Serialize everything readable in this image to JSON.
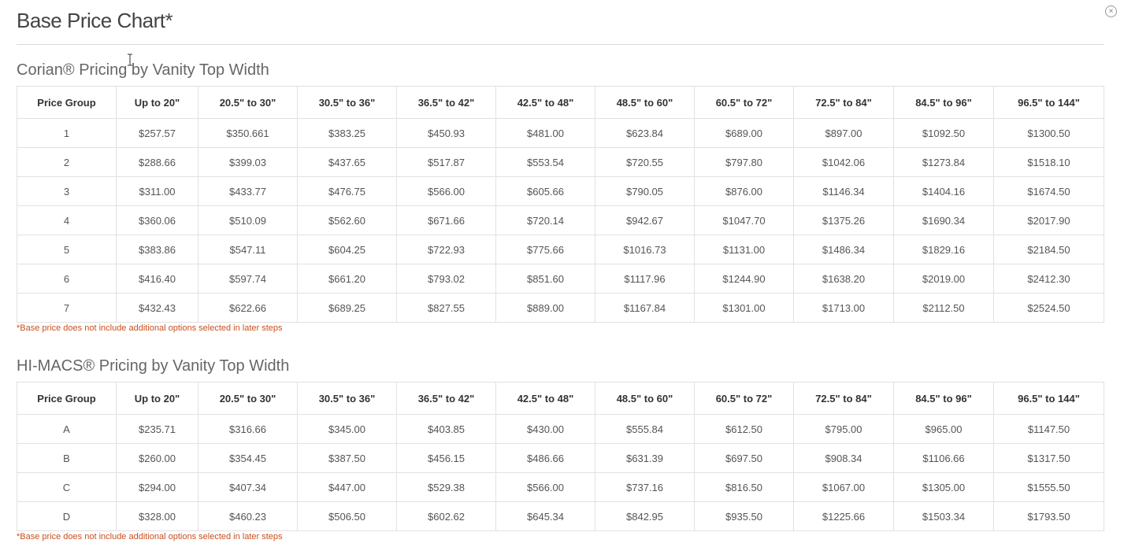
{
  "modal": {
    "title": "Base Price Chart*",
    "close_symbol": "×"
  },
  "columns": [
    "Price Group",
    "Up to 20\"",
    "20.5\" to 30\"",
    "30.5\" to 36\"",
    "36.5\" to 42\"",
    "42.5\" to 48\"",
    "48.5\" to 60\"",
    "60.5\" to 72\"",
    "72.5\" to 84\"",
    "84.5\" to 96\"",
    "96.5\" to 144\""
  ],
  "corian": {
    "title": "Corian® Pricing by Vanity Top Width",
    "rows": [
      [
        "1",
        "$257.57",
        "$350.661",
        "$383.25",
        "$450.93",
        "$481.00",
        "$623.84",
        "$689.00",
        "$897.00",
        "$1092.50",
        "$1300.50"
      ],
      [
        "2",
        "$288.66",
        "$399.03",
        "$437.65",
        "$517.87",
        "$553.54",
        "$720.55",
        "$797.80",
        "$1042.06",
        "$1273.84",
        "$1518.10"
      ],
      [
        "3",
        "$311.00",
        "$433.77",
        "$476.75",
        "$566.00",
        "$605.66",
        "$790.05",
        "$876.00",
        "$1146.34",
        "$1404.16",
        "$1674.50"
      ],
      [
        "4",
        "$360.06",
        "$510.09",
        "$562.60",
        "$671.66",
        "$720.14",
        "$942.67",
        "$1047.70",
        "$1375.26",
        "$1690.34",
        "$2017.90"
      ],
      [
        "5",
        "$383.86",
        "$547.11",
        "$604.25",
        "$722.93",
        "$775.66",
        "$1016.73",
        "$1131.00",
        "$1486.34",
        "$1829.16",
        "$2184.50"
      ],
      [
        "6",
        "$416.40",
        "$597.74",
        "$661.20",
        "$793.02",
        "$851.60",
        "$1117.96",
        "$1244.90",
        "$1638.20",
        "$2019.00",
        "$2412.30"
      ],
      [
        "7",
        "$432.43",
        "$622.66",
        "$689.25",
        "$827.55",
        "$889.00",
        "$1167.84",
        "$1301.00",
        "$1713.00",
        "$2112.50",
        "$2524.50"
      ]
    ],
    "footnote": "*Base price does not include additional options selected in later steps"
  },
  "himacs": {
    "title": "HI-MACS® Pricing by Vanity Top Width",
    "rows": [
      [
        "A",
        "$235.71",
        "$316.66",
        "$345.00",
        "$403.85",
        "$430.00",
        "$555.84",
        "$612.50",
        "$795.00",
        "$965.00",
        "$1147.50"
      ],
      [
        "B",
        "$260.00",
        "$354.45",
        "$387.50",
        "$456.15",
        "$486.66",
        "$631.39",
        "$697.50",
        "$908.34",
        "$1106.66",
        "$1317.50"
      ],
      [
        "C",
        "$294.00",
        "$407.34",
        "$447.00",
        "$529.38",
        "$566.00",
        "$737.16",
        "$816.50",
        "$1067.00",
        "$1305.00",
        "$1555.50"
      ],
      [
        "D",
        "$328.00",
        "$460.23",
        "$506.50",
        "$602.62",
        "$645.34",
        "$842.95",
        "$935.50",
        "$1225.66",
        "$1503.34",
        "$1793.50"
      ]
    ],
    "footnote": "*Base price does not include additional options selected in later steps"
  },
  "icons": {
    "close": "close-icon",
    "cursor": "text-cursor-icon"
  }
}
